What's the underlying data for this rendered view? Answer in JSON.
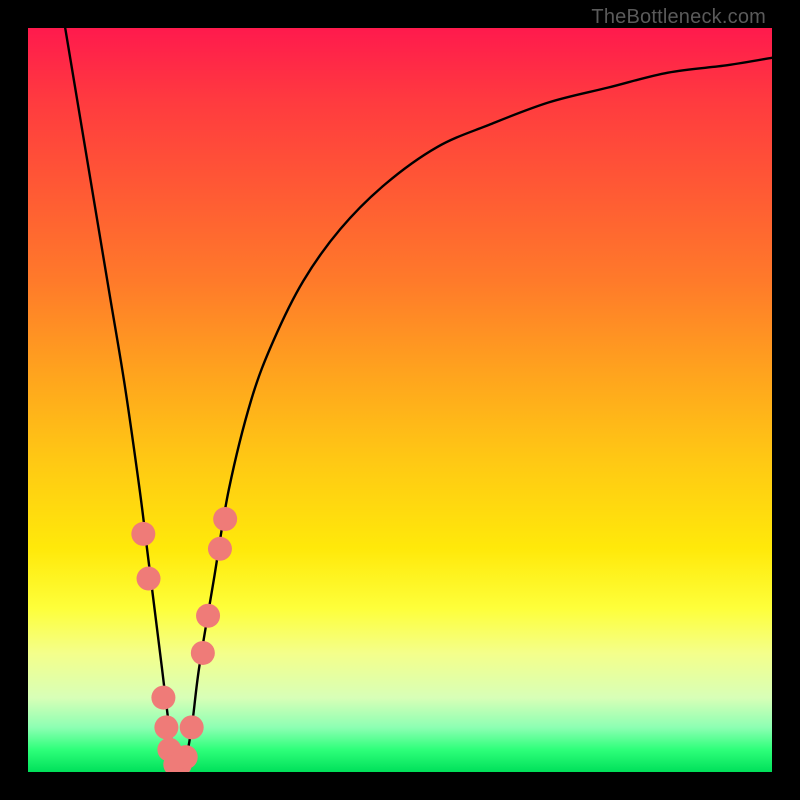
{
  "attribution": "TheBottleneck.com",
  "chart_data": {
    "type": "line",
    "title": "",
    "xlabel": "",
    "ylabel": "",
    "xlim": [
      0,
      100
    ],
    "ylim": [
      0,
      100
    ],
    "grid": false,
    "legend": false,
    "series": [
      {
        "name": "bottleneck-curve",
        "color": "#000000",
        "x": [
          5,
          7,
          9,
          11,
          13,
          15,
          16,
          17,
          18,
          19,
          20,
          21,
          22,
          23,
          25,
          27,
          30,
          33,
          37,
          42,
          48,
          55,
          62,
          70,
          78,
          86,
          94,
          100
        ],
        "y": [
          100,
          88,
          76,
          64,
          52,
          38,
          30,
          22,
          14,
          6,
          1,
          1,
          6,
          14,
          26,
          38,
          50,
          58,
          66,
          73,
          79,
          84,
          87,
          90,
          92,
          94,
          95,
          96
        ]
      }
    ],
    "markers": [
      {
        "name": "sample-points-left",
        "color": "#ef7b78",
        "radius": 12,
        "x": [
          15.5,
          16.2,
          18.2,
          18.6,
          19.0,
          19.8,
          20.4
        ],
        "y": [
          32,
          26,
          10,
          6,
          3,
          1,
          1
        ]
      },
      {
        "name": "sample-points-right",
        "color": "#ef7b78",
        "radius": 12,
        "x": [
          21.2,
          22.0,
          23.5,
          24.2,
          25.8,
          26.5
        ],
        "y": [
          2,
          6,
          16,
          21,
          30,
          34
        ]
      }
    ],
    "gradient_stops": [
      {
        "pos": 0.0,
        "color": "#ff1a4d"
      },
      {
        "pos": 0.1,
        "color": "#ff3b3f"
      },
      {
        "pos": 0.22,
        "color": "#ff5a34"
      },
      {
        "pos": 0.34,
        "color": "#ff7a2a"
      },
      {
        "pos": 0.46,
        "color": "#ffa21e"
      },
      {
        "pos": 0.58,
        "color": "#ffc814"
      },
      {
        "pos": 0.7,
        "color": "#ffe90a"
      },
      {
        "pos": 0.78,
        "color": "#feff3a"
      },
      {
        "pos": 0.84,
        "color": "#f4ff8a"
      },
      {
        "pos": 0.9,
        "color": "#d8ffb7"
      },
      {
        "pos": 0.94,
        "color": "#8dffb3"
      },
      {
        "pos": 0.97,
        "color": "#2eff7a"
      },
      {
        "pos": 1.0,
        "color": "#00e05a"
      }
    ]
  }
}
